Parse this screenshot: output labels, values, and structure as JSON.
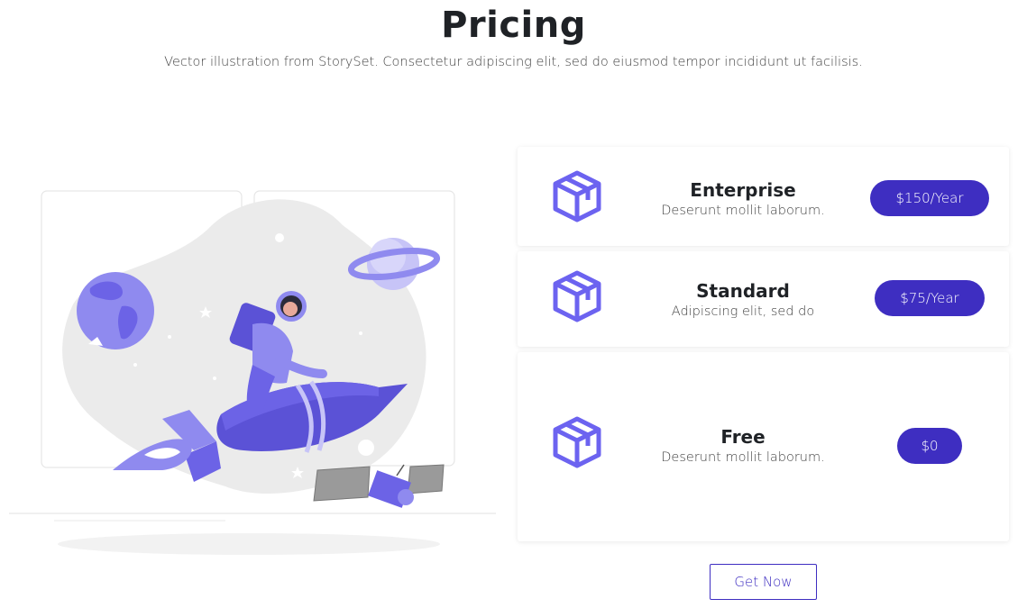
{
  "header": {
    "title": "Pricing",
    "subtitle": "Vector illustration from StorySet. Consectetur adipiscing elit, sed do eiusmod tempor incididunt ut facilisis."
  },
  "plans": [
    {
      "name": "Enterprise",
      "description": "Deserunt mollit laborum.",
      "price": "$150/Year",
      "icon": "box-icon"
    },
    {
      "name": "Standard",
      "description": "Adipiscing elit, sed do",
      "price": "$75/Year",
      "icon": "box-icon"
    },
    {
      "name": "Free",
      "description": "Deserunt mollit laborum.",
      "price": "$0",
      "icon": "box-icon"
    }
  ],
  "cta": {
    "label": "Get Now"
  },
  "colors": {
    "accent": "#3e2ec1",
    "icon": "#6c63f0",
    "illustration_primary": "#6c63e6",
    "illustration_light": "#8f8aef"
  }
}
